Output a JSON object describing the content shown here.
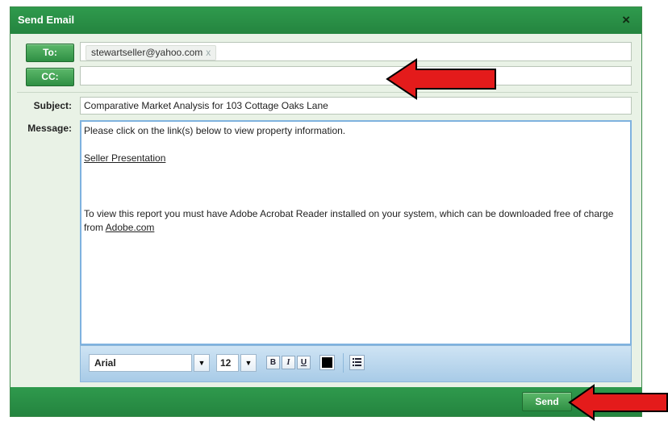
{
  "dialog": {
    "title": "Send Email",
    "close": "×"
  },
  "to": {
    "label": "To:",
    "recipients": [
      "stewartseller@yahoo.com"
    ],
    "remove": "x"
  },
  "cc": {
    "label": "CC:",
    "value": ""
  },
  "subject": {
    "label": "Subject:",
    "value": "Comparative Market Analysis for 103 Cottage Oaks Lane"
  },
  "message": {
    "label": "Message:",
    "line1": "Please click on the link(s) below to view property information.",
    "link1": "Seller Presentation",
    "line2a": "To view this report you must have Adobe Acrobat Reader installed on your system, which can be downloaded free of charge",
    "line2b_prefix": "from ",
    "link2": "Adobe.com"
  },
  "toolbar": {
    "font": "Arial",
    "size": "12",
    "bold": "B",
    "italic": "I",
    "underline": "U",
    "color": "#000000",
    "list_icon": "list-icon"
  },
  "footer": {
    "send": "Send"
  },
  "colors": {
    "green": "#2f9a4d",
    "arrow": "#e41b1b",
    "editor_border": "#7fb2df"
  }
}
